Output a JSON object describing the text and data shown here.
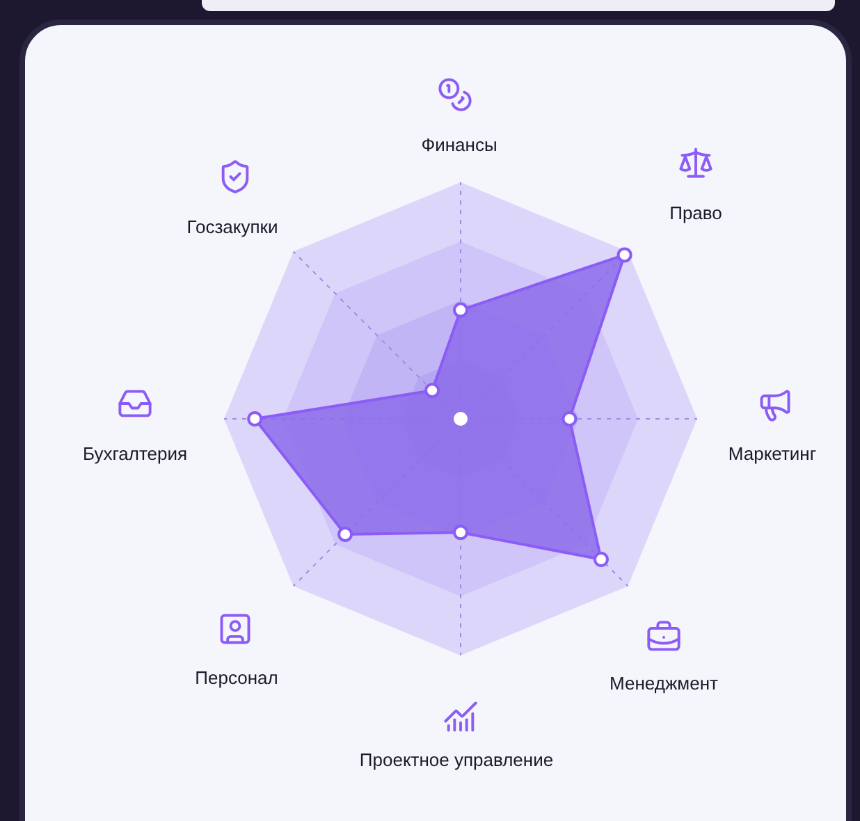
{
  "radar": {
    "axes": [
      {
        "label": "Финансы"
      },
      {
        "label": "Право"
      },
      {
        "label": "Маркетинг"
      },
      {
        "label": "Менеджмент"
      },
      {
        "label": "Проектное управление"
      },
      {
        "label": "Персонал"
      },
      {
        "label": "Бухгалтерия"
      },
      {
        "label": "Госзакупки"
      }
    ]
  }
}
